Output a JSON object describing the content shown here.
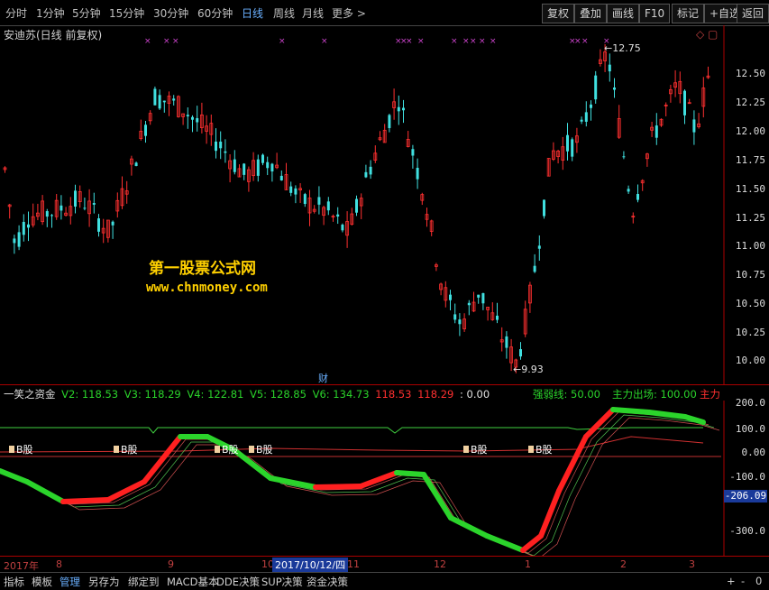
{
  "toolbar": {
    "periods": [
      "分时",
      "1分钟",
      "5分钟",
      "15分钟",
      "30分钟",
      "60分钟",
      "日线",
      "周线",
      "月线",
      "更多 >"
    ],
    "active_period": "日线",
    "buttons": [
      "复权",
      "叠加",
      "画线",
      "F10",
      "标记",
      "+自选",
      "返回"
    ]
  },
  "main_chart": {
    "title": "安迪苏(日线 前复权)",
    "price_labels": [
      "12.50",
      "12.25",
      "12.00",
      "11.75",
      "11.50",
      "11.25",
      "11.00",
      "10.75",
      "10.50",
      "10.25",
      "10.00"
    ],
    "high_label": "12.75",
    "low_label": "9.93",
    "finance_marker": "财",
    "watermark_line1": "第一股票公式网",
    "watermark_line2": "www.chnmoney.com",
    "marker_symbol": "×",
    "colors": {
      "up": "#ff3030",
      "down": "#40e0e0",
      "marker": "#cc44cc"
    }
  },
  "indicator": {
    "name": "一笑之资金",
    "values": [
      {
        "text": "V2: 118.53",
        "color": "#2bd42b"
      },
      {
        "text": "V3: 118.29",
        "color": "#2bd42b"
      },
      {
        "text": "V4: 122.81",
        "color": "#2bd42b"
      },
      {
        "text": "V5: 128.85",
        "color": "#2bd42b"
      },
      {
        "text": "V6: 134.73",
        "color": "#2bd42b"
      },
      {
        "text": "118.53",
        "color": "#ff3030"
      },
      {
        "text": "118.29",
        "color": "#ff3030"
      },
      {
        "text": ": 0.00",
        "color": "#e0e0e0"
      }
    ],
    "strength_line": "强弱线: 50.00",
    "main_exit": "主力出场: 100.00",
    "main_force": "主力",
    "y_labels": [
      "200.0",
      "100.0",
      "0.00",
      "-100.0",
      "-300.0"
    ],
    "current_value": "-206.09",
    "signal_text": "B股",
    "colors": {
      "green": "#2bd42b",
      "red": "#ff2020"
    }
  },
  "xaxis": {
    "labels": [
      "2017年",
      "8",
      "9",
      "10",
      "2017/10/12/四",
      "11",
      "12",
      "1",
      "2",
      "3"
    ]
  },
  "bottom_tabs": [
    "指标",
    "模板",
    "管理",
    "另存为",
    "绑定到",
    "MACD基本",
    "DDE决策",
    "SUP决策",
    "资金决策"
  ],
  "active_tab": "管理",
  "bottom_right_buttons": [
    "+",
    "-",
    "0"
  ]
}
